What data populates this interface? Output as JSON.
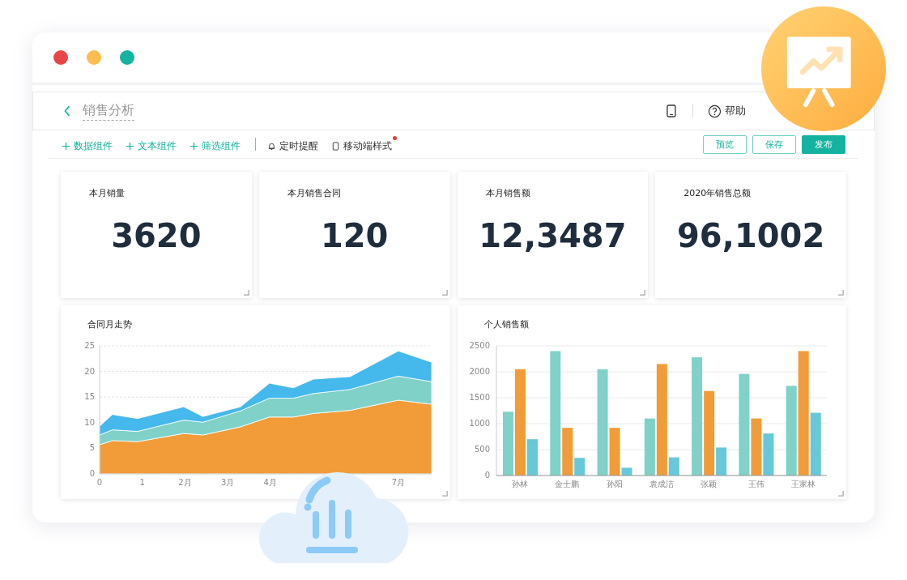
{
  "window": {
    "controls": [
      {
        "color": "#e84646"
      },
      {
        "color": "#fbbd4f"
      },
      {
        "color": "#13b3a0"
      }
    ]
  },
  "header": {
    "title": "销售分析",
    "help": "帮助"
  },
  "toolbar": {
    "items": [
      {
        "kind": "add",
        "label": "数据组件",
        "badge": false
      },
      {
        "kind": "add",
        "label": "文本组件",
        "badge": false
      },
      {
        "kind": "add",
        "label": "筛选组件",
        "badge": false
      },
      {
        "kind": "bell",
        "label": "定时提醒",
        "badge": false
      },
      {
        "kind": "phone",
        "label": "移动端样式",
        "badge": true
      }
    ],
    "buttons": [
      {
        "kind": "outline",
        "label": "预览"
      },
      {
        "kind": "outline",
        "label": "保存"
      },
      {
        "kind": "primary",
        "label": "发布"
      }
    ]
  },
  "stats": [
    {
      "title": "本月销量",
      "value": "3620"
    },
    {
      "title": "本月销售合同",
      "value": "120"
    },
    {
      "title": "本月销售额",
      "value": "12,3487"
    },
    {
      "title": "2020年销售总额",
      "value": "96,1002"
    }
  ],
  "charts": [
    {
      "title": "合同月走势",
      "chart_data": {
        "type": "area",
        "stacked": true,
        "grid": true,
        "x": [
          0,
          0.3,
          0.89,
          1.97,
          2.42,
          3.3,
          3.98,
          4.54,
          5.01,
          5.87,
          7.0,
          7.78
        ],
        "series": [
          {
            "color": "#f19c38",
            "values": [
              5.7,
              6.5,
              6.3,
              7.9,
              7.6,
              9.2,
              11.1,
              11.1,
              11.8,
              12.4,
              14.4,
              13.6
            ]
          },
          {
            "color": "#80d1c8",
            "values": [
              1.9,
              2.1,
              2.0,
              2.6,
              2.5,
              3.1,
              3.7,
              3.7,
              3.9,
              4.1,
              4.7,
              4.4
            ]
          },
          {
            "color": "#45b8ec",
            "values": [
              1.7,
              3.0,
              2.5,
              2.6,
              1.1,
              0.8,
              2.9,
              2.0,
              2.8,
              2.5,
              4.9,
              3.8
            ]
          }
        ],
        "xlim": [
          0,
          7.78
        ],
        "ylim": [
          0,
          25
        ],
        "yticks": [
          0,
          5,
          10,
          15,
          20,
          25
        ],
        "xticks": [
          0,
          1,
          {
            "value": 2,
            "label": "2月"
          },
          {
            "value": 3,
            "label": "3月"
          },
          {
            "value": 4,
            "label": "4月"
          },
          {
            "value": 7,
            "label": "7月"
          }
        ]
      }
    },
    {
      "title": "个人销售额",
      "chart_data": {
        "type": "bar",
        "grid": true,
        "categories": [
          "孙林",
          "金士鹏",
          "孙阳",
          "袁成洁",
          "张颖",
          "王伟",
          "王家林"
        ],
        "series": [
          {
            "color": "#80d1c8",
            "values": [
              1230,
              2400,
              2050,
              1100,
              2280,
              1960,
              1730
            ]
          },
          {
            "color": "#f19c38",
            "values": [
              2050,
              920,
              920,
              2150,
              1630,
              1100,
              2400
            ]
          },
          {
            "color": "#66c8d9",
            "values": [
              700,
              340,
              150,
              350,
              540,
              810,
              1210
            ]
          }
        ],
        "ylim": [
          0,
          2500
        ],
        "yticks": [
          0,
          500,
          1000,
          1500,
          2000,
          2500
        ]
      }
    }
  ]
}
